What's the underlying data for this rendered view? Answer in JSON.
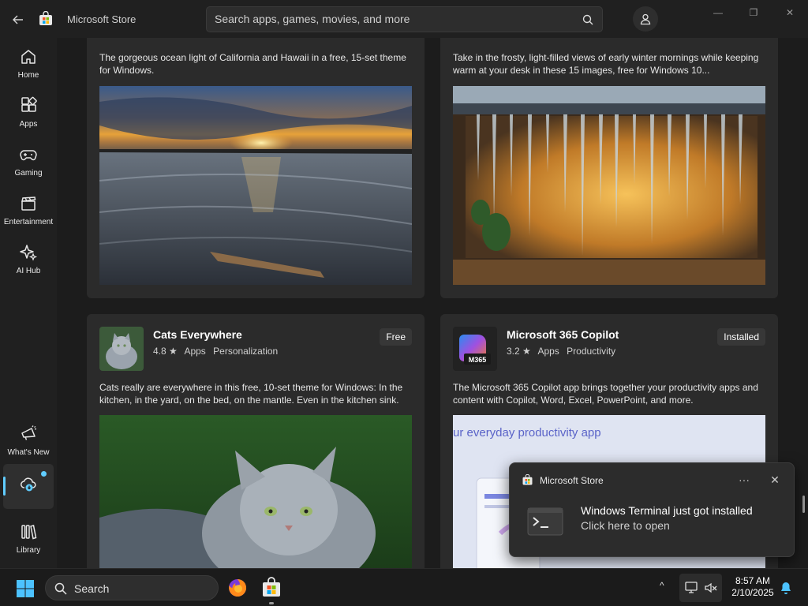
{
  "titlebar": {
    "app_title": "Microsoft Store",
    "search_placeholder": "Search apps, games, movies, and more",
    "minimize": "—",
    "maximize": "❐",
    "close": "✕"
  },
  "sidebar": {
    "items": [
      {
        "label": "Home",
        "icon": "home-icon"
      },
      {
        "label": "Apps",
        "icon": "apps-icon"
      },
      {
        "label": "Gaming",
        "icon": "gamepad-icon"
      },
      {
        "label": "Entertainment",
        "icon": "clapperboard-icon"
      },
      {
        "label": "AI Hub",
        "icon": "sparkle-icon"
      },
      {
        "label": "What's New",
        "icon": "megaphone-icon"
      },
      {
        "label": "",
        "icon": "downloads-icon",
        "active": true,
        "badge": true
      },
      {
        "label": "Library",
        "icon": "library-icon"
      }
    ]
  },
  "cards": [
    {
      "description": "The gorgeous ocean light of California and Hawaii in a free, 15-set theme for Windows."
    },
    {
      "description": "Take in the frosty, light-filled views of early winter mornings while keeping warm at your desk in these 15 images, free for Windows 10..."
    },
    {
      "name": "Cats Everywhere",
      "rating": "4.8 ★",
      "category": "Apps",
      "subcategory": "Personalization",
      "price": "Free",
      "description": "Cats really are everywhere in this free, 10-set theme for Windows: In the kitchen, in the yard, on the bed, on the mantle. Even in the kitchen sink."
    },
    {
      "name": "Microsoft 365 Copilot",
      "rating": "3.2 ★",
      "category": "Apps",
      "subcategory": "Productivity",
      "price": "Installed",
      "icon_text": "M365",
      "description": "The Microsoft 365 Copilot app brings together your productivity apps and content with Copilot, Word, Excel, PowerPoint, and more.",
      "screenshot_caption": "ur everyday productivity app"
    }
  ],
  "notification": {
    "app": "Microsoft Store",
    "title": "Windows Terminal just got installed",
    "subtitle": "Click here to open",
    "more": "···",
    "close": "✕"
  },
  "taskbar": {
    "search_label": "Search",
    "time": "8:57 AM",
    "date": "2/10/2025",
    "tray_chevron": "^"
  },
  "colors": {
    "accent": "#60cdff",
    "background": "#202020",
    "card": "#2b2b2b"
  }
}
